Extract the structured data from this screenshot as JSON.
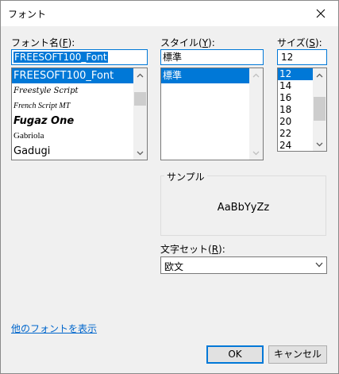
{
  "window": {
    "title": "フォント"
  },
  "icons": {
    "close": "close-icon",
    "scroll_up": "chevron-up-icon",
    "scroll_down": "chevron-down-icon",
    "dropdown": "chevron-down-icon"
  },
  "font": {
    "label": "フォント名(",
    "accel": "F",
    "label_end": "):",
    "value": "FREESOFT100_Font",
    "items": [
      "FREESOFT100_Font",
      "Freestyle Script",
      "French Script MT",
      "Fugaz One",
      "Gabriola",
      "Gadugi"
    ]
  },
  "style": {
    "label": "スタイル(",
    "accel": "Y",
    "label_end": "):",
    "value": "標準",
    "items": [
      "標準"
    ]
  },
  "size": {
    "label": "サイズ(",
    "accel": "S",
    "label_end": "):",
    "value": "12",
    "items": [
      "12",
      "14",
      "16",
      "18",
      "20",
      "22",
      "24"
    ]
  },
  "sample": {
    "label": "サンプル",
    "text": "AaBbYyZz"
  },
  "charset": {
    "label": "文字セット(",
    "accel": "R",
    "label_end": "):",
    "value": "欧文"
  },
  "more_fonts_link": "他のフォントを表示",
  "buttons": {
    "ok": "OK",
    "cancel": "キャンセル"
  },
  "colors": {
    "accent": "#0078d7",
    "dialog_bg": "#f0f0f0",
    "link": "#0066cc"
  }
}
